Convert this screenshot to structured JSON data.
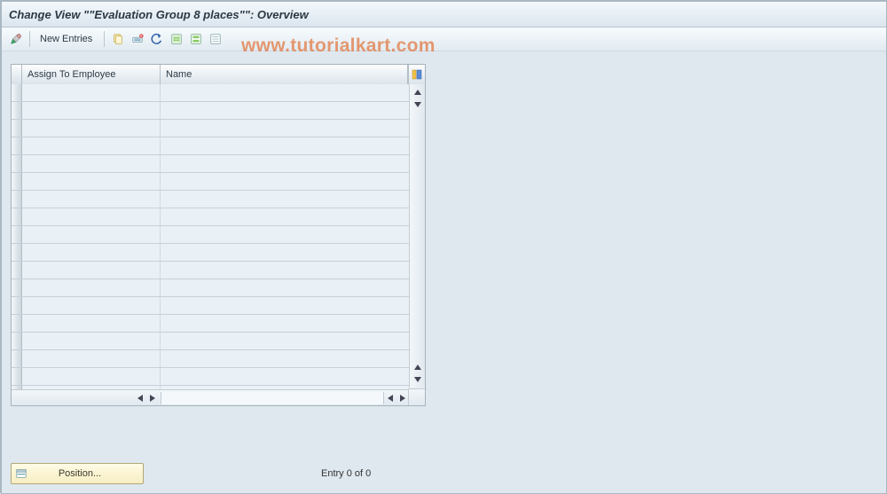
{
  "title": "Change View \"\"Evaluation Group 8 places\"\": Overview",
  "watermark": "www.tutorialkart.com",
  "toolbar": {
    "new_entries": "New Entries"
  },
  "table": {
    "columns": [
      {
        "key": "assign",
        "label": "Assign To Employee"
      },
      {
        "key": "name",
        "label": "Name"
      }
    ],
    "row_count": 18
  },
  "footer": {
    "position_label": "Position...",
    "entry_status": "Entry 0 of 0"
  }
}
